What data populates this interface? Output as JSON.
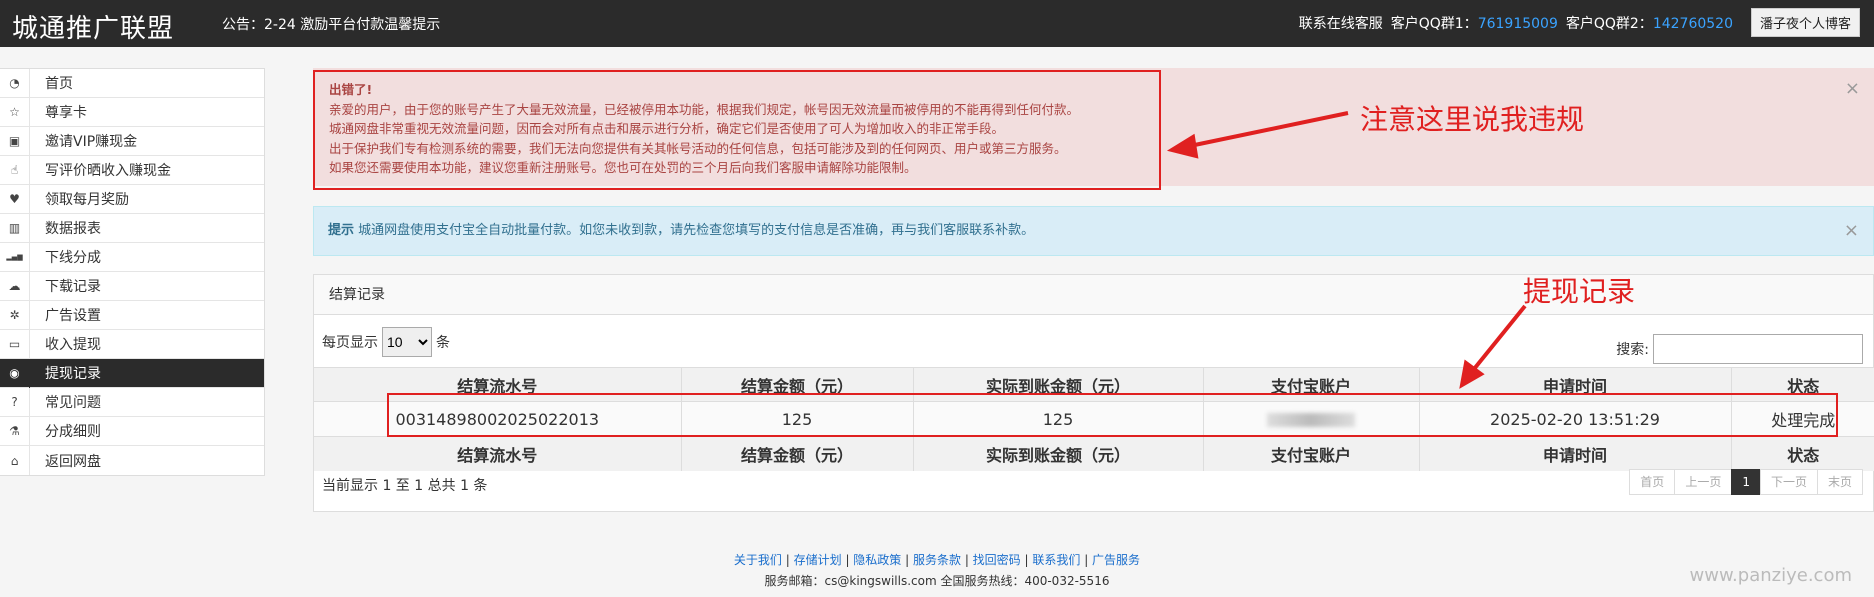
{
  "header": {
    "brand": "城通推广联盟",
    "notice": "公告：2-24 激励平台付款温馨提示",
    "contact_label": "联系在线客服",
    "qq1_label": "客户QQ群1：",
    "qq1_value": "761915009",
    "qq2_label": "客户QQ群2：",
    "qq2_value": "142760520",
    "user_button": "潘子夜个人博客"
  },
  "sidebar": {
    "items": [
      {
        "label": "首页",
        "icon": "dashboard-icon"
      },
      {
        "label": "尊享卡",
        "icon": "star-icon"
      },
      {
        "label": "邀请VIP赚现金",
        "icon": "gift-icon"
      },
      {
        "label": "写评价晒收入赚现金",
        "icon": "thumbs-up-icon"
      },
      {
        "label": "领取每月奖励",
        "icon": "heart-icon"
      },
      {
        "label": "数据报表",
        "icon": "bar-chart-icon"
      },
      {
        "label": "下线分成",
        "icon": "signal-icon"
      },
      {
        "label": "下载记录",
        "icon": "cloud-download-icon"
      },
      {
        "label": "广告设置",
        "icon": "gear-icon"
      },
      {
        "label": "收入提现",
        "icon": "credit-card-icon"
      },
      {
        "label": "提现记录",
        "icon": "money-icon"
      },
      {
        "label": "常见问题",
        "icon": "question-icon"
      },
      {
        "label": "分成细则",
        "icon": "flask-icon"
      },
      {
        "label": "返回网盘",
        "icon": "home-icon"
      }
    ],
    "active_index": 10
  },
  "alert_danger": {
    "title": "出错了!",
    "lines": [
      "亲爱的用户，由于您的账号产生了大量无效流量，已经被停用本功能，根据我们规定，帐号因无效流量而被停用的不能再得到任何付款。",
      "城通网盘非常重视无效流量问题，因而会对所有点击和展示进行分析，确定它们是否使用了可人为增加收入的非正常手段。",
      "出于保护我们专有检测系统的需要，我们无法向您提供有关其帐号活动的任何信息，包括可能涉及到的任何网页、用户或第三方服务。",
      "如果您还需要使用本功能，建议您重新注册账号。您也可在处罚的三个月后向我们客服申请解除功能限制。"
    ],
    "close": "×"
  },
  "annotations": {
    "violation": "注意这里说我违规",
    "record": "提现记录"
  },
  "alert_info": {
    "strong": "提示",
    "text": " 城通网盘使用支付宝全自动批量付款。如您未收到款，请先检查您填写的支付信息是否准确，再与我们客服联系补款。",
    "close": "×"
  },
  "panel": {
    "title": "结算记录",
    "length_prefix": "每页显示",
    "length_value": "10",
    "length_suffix": "条",
    "search_label": "搜索:",
    "columns": [
      "结算流水号",
      "结算金额（元）",
      "实际到账金额（元）",
      "支付宝账户",
      "申请时间",
      "状态"
    ],
    "rows": [
      {
        "serial": "00314898002025022013",
        "amount": "125",
        "actual": "125",
        "alipay": "",
        "time": "2025-02-20 13:51:29",
        "status": "处理完成"
      }
    ],
    "info": "当前显示 1 至 1 总共 1 条",
    "pager": [
      "首页",
      "上一页",
      "1",
      "下一页",
      "末页"
    ]
  },
  "footer": {
    "links": [
      "关于我们",
      "存储计划",
      "隐私政策",
      "服务条款",
      "找回密码",
      "联系我们",
      "广告服务"
    ],
    "contact": "服务邮箱：cs@kingswills.com    全国服务热线：400-032-5516"
  },
  "watermark": "www.panziye.com",
  "colors": {
    "annotation": "#e02020",
    "active_sidebar": "#2b2b2b",
    "link": "#3aa3ff"
  }
}
